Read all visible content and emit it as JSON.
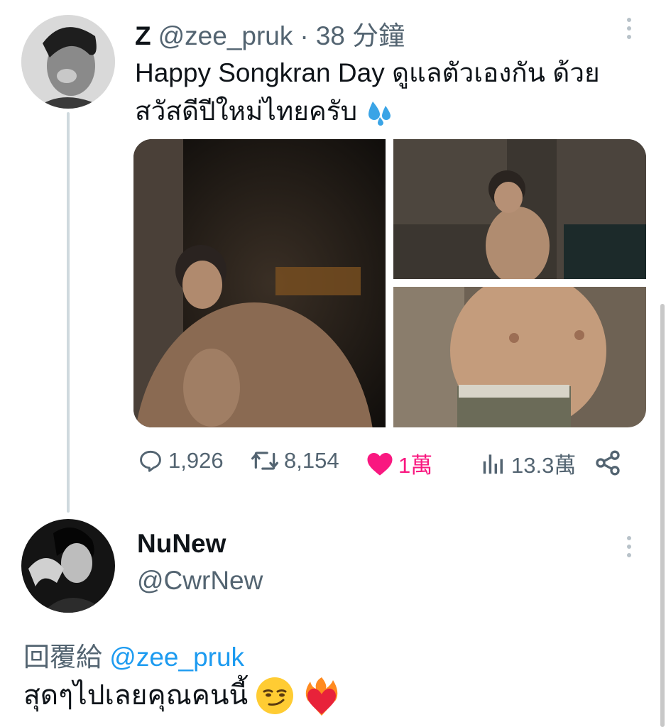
{
  "tweet": {
    "display_name": "Z",
    "handle": "@zee_pruk",
    "separator": "·",
    "time": "38 分鐘",
    "text": "Happy Songkran Day ดูแลตัวเองกัน ด้วย สวัสดีปีใหม่ไทยครับ",
    "text_emoji": "sweat-droplets",
    "photos": [
      "photo-1",
      "photo-2",
      "photo-3"
    ],
    "actions": {
      "replies": "1,926",
      "retweets": "8,154",
      "likes": "1萬",
      "views": "13.3萬"
    }
  },
  "reply": {
    "display_name": "NuNew",
    "handle": "@CwrNew",
    "reply_to_label": "回覆給",
    "reply_to_handle": "@zee_pruk",
    "text": "สุดๆไปเลยคุณคนนี้",
    "emojis": [
      "smirking-face",
      "heart-on-fire"
    ]
  },
  "colors": {
    "like": "#f91880",
    "mention": "#1d9bf0",
    "muted": "#536471",
    "thread_line": "#cfd9de"
  }
}
